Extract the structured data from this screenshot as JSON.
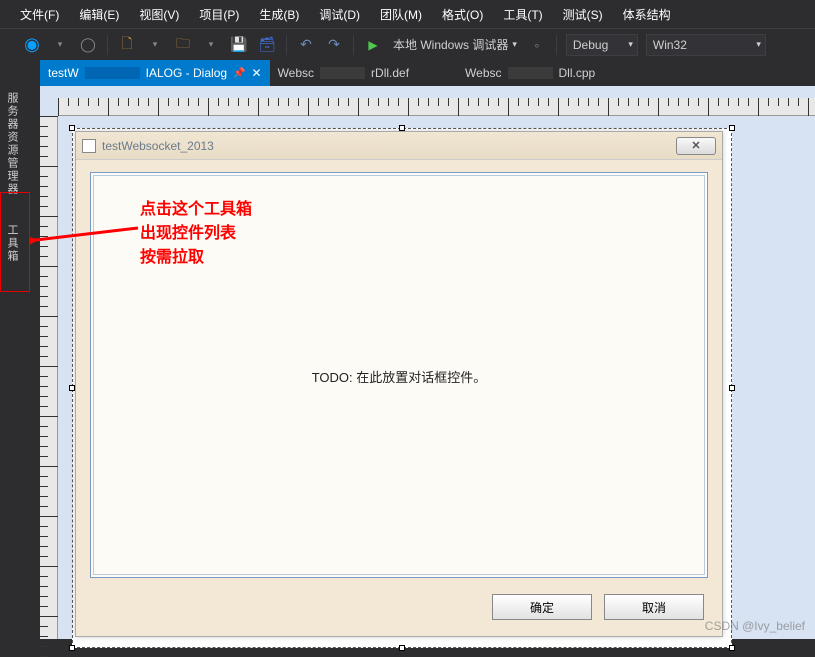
{
  "menu": {
    "file": "文件(F)",
    "edit": "编辑(E)",
    "view": "视图(V)",
    "project": "项目(P)",
    "build": "生成(B)",
    "debug": "调试(D)",
    "team": "团队(M)",
    "format": "格式(O)",
    "tools": "工具(T)",
    "test": "测试(S)",
    "arch": "体系结构"
  },
  "toolbar": {
    "debugger_label": "本地 Windows 调试器",
    "config": "Debug",
    "platform": "Win32"
  },
  "tabs": {
    "t1": {
      "prefix": "testW",
      "suffix": "IALOG - Dialog"
    },
    "t2": {
      "prefix": "Websc",
      "suffix": "rDll.def"
    },
    "t3": {
      "prefix": "Websc",
      "suffix": "Dll.cpp"
    }
  },
  "side": {
    "explorer": "服务器资源管理器",
    "toolbox": "工具箱"
  },
  "dialog": {
    "title": "testWebsocket_2013",
    "todo": "TODO:  在此放置对话框控件。",
    "ok": "确定",
    "cancel": "取消"
  },
  "annotation": {
    "line1": "点击这个工具箱",
    "line2": "出现控件列表",
    "line3": "按需拉取"
  },
  "watermark": "CSDN @Ivy_belief"
}
